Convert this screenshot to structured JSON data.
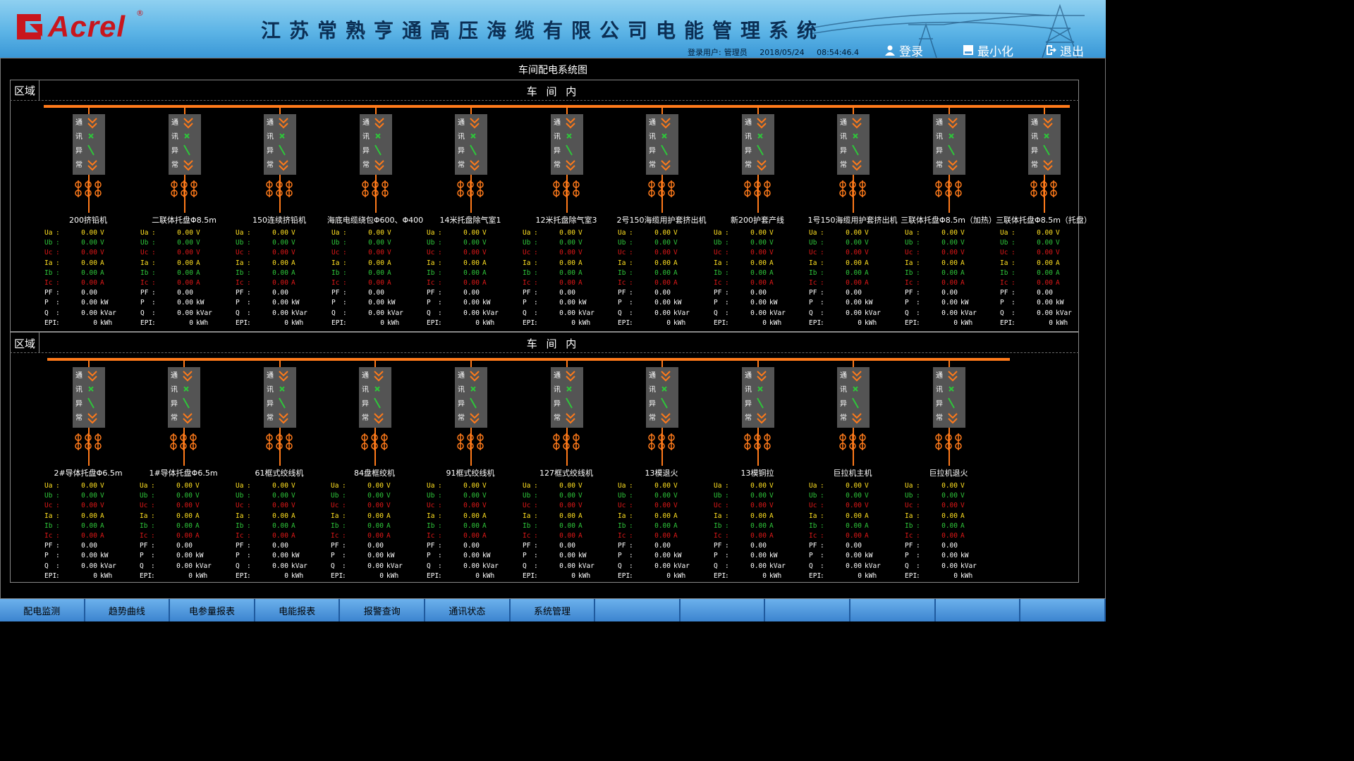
{
  "header": {
    "brand": "Acrel",
    "registered": "®",
    "title": "江苏常熟亨通高压海缆有限公司电能管理系统",
    "user_label": "登录用户:",
    "user": "管理员",
    "date": "2018/05/24",
    "time": "08:54:46.4",
    "login": "登录",
    "minimize": "最小化",
    "logout": "退出"
  },
  "page_title": "车间配电系统图",
  "sections": [
    {
      "region_label": "区域",
      "region_name": "车 间 内",
      "feeders": [
        {
          "name": "200挤铅机"
        },
        {
          "name": "二联体托盘Φ8.5m"
        },
        {
          "name": "150连续挤铅机"
        },
        {
          "name": "海底电缆绕包Φ600、Φ400"
        },
        {
          "name": "14米托盘除气室1"
        },
        {
          "name": "12米托盘除气室3"
        },
        {
          "name": "2号150海缆用护套挤出机"
        },
        {
          "name": "新200护套产线"
        },
        {
          "name": "1号150海缆用护套挤出机"
        },
        {
          "name": "三联体托盘Φ8.5m（加热）"
        },
        {
          "name": "三联体托盘Φ8.5m（托盘）"
        }
      ]
    },
    {
      "region_label": "区域",
      "region_name": "车 间 内",
      "feeders": [
        {
          "name": "2#导体托盘Φ6.5m"
        },
        {
          "name": "1#导体托盘Φ6.5m"
        },
        {
          "name": "61框式绞线机"
        },
        {
          "name": "84盘框绞机"
        },
        {
          "name": "91框式绞线机"
        },
        {
          "name": "127框式绞线机"
        },
        {
          "name": "13模退火"
        },
        {
          "name": "13模铜拉"
        },
        {
          "name": "巨拉机主机"
        },
        {
          "name": "巨拉机退火"
        }
      ]
    }
  ],
  "status_chars": [
    "通",
    "讯",
    "异",
    "常"
  ],
  "measurements": [
    {
      "label": "Ua",
      "value": "0.00",
      "unit": "V",
      "color": "#ffe020"
    },
    {
      "label": "Ub",
      "value": "0.00",
      "unit": "V",
      "color": "#2ec63a"
    },
    {
      "label": "Uc",
      "value": "0.00",
      "unit": "V",
      "color": "#e01818"
    },
    {
      "label": "Ia",
      "value": "0.00",
      "unit": "A",
      "color": "#ffe020"
    },
    {
      "label": "Ib",
      "value": "0.00",
      "unit": "A",
      "color": "#2ec63a"
    },
    {
      "label": "Ic",
      "value": "0.00",
      "unit": "A",
      "color": "#e01818"
    },
    {
      "label": "PF",
      "value": "0.00",
      "unit": "",
      "color": "#ffffff"
    },
    {
      "label": "P",
      "value": "0.00",
      "unit": "kW",
      "color": "#ffffff"
    },
    {
      "label": "Q",
      "value": "0.00",
      "unit": "kVar",
      "color": "#ffffff"
    },
    {
      "label": "EPI",
      "value": "0",
      "unit": "kWh",
      "color": "#ffffff"
    }
  ],
  "nav": {
    "tabs": [
      "配电监测",
      "趋势曲线",
      "电参量报表",
      "电能报表",
      "报警查询",
      "通讯状态",
      "系统管理",
      "",
      "",
      "",
      "",
      "",
      ""
    ]
  },
  "colors": {
    "bus": "#ff7a1a",
    "switch_closed": "#2ec63a",
    "header_bg": "#5cb4e6"
  }
}
